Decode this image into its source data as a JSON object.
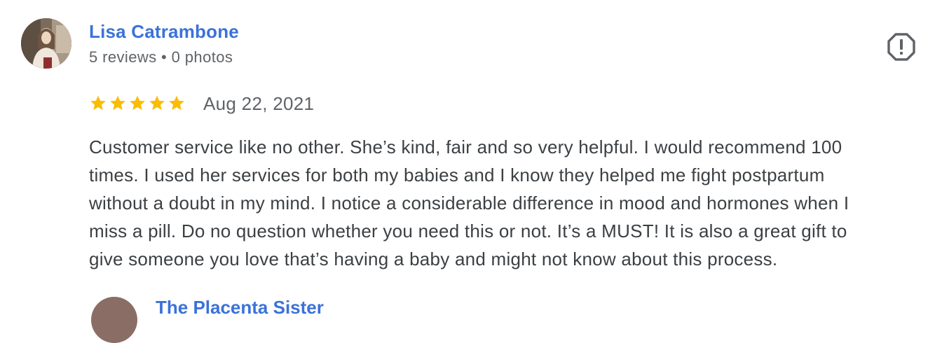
{
  "review": {
    "reviewer_name": "Lisa Catrambone",
    "reviewer_meta": "5 reviews • 0 photos",
    "rating": 5,
    "rating_max": 5,
    "date": "Aug 22, 2021",
    "text_lines": [
      "Customer service like no other. She’s kind, fair and so very helpful. I would recommend 100",
      "times. I used her services for both my babies and I know they helped me fight postpartum",
      "without a doubt in my mind. I notice a considerable difference in mood and hormones when I",
      "miss a pill. Do no question whether you need this or not. It’s a MUST! It is also a great gift to",
      "give someone you love that’s having a baby and might not know about this process."
    ],
    "report_icon": "report-flag-icon"
  },
  "next_review": {
    "reviewer_name": "The Placenta Sister"
  },
  "colors": {
    "name": "#3b72d9",
    "meta": "#5f6368",
    "text": "#3c4043",
    "star": "#fbbc04",
    "icon": "#5f6368"
  }
}
